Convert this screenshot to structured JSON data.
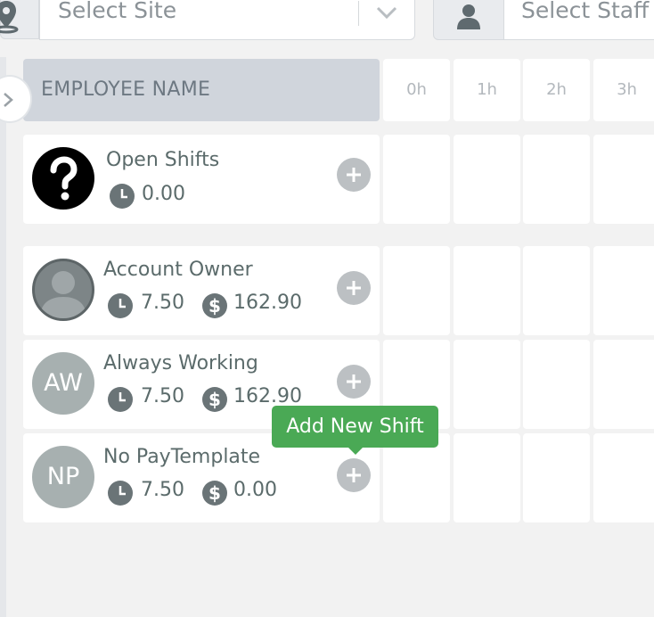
{
  "filters": {
    "site_placeholder": "Select Site",
    "staff_placeholder": "Select Staff"
  },
  "header": {
    "employee_column": "EMPLOYEE NAME",
    "hours": [
      "0h",
      "1h",
      "2h",
      "3h"
    ]
  },
  "rows": [
    {
      "name": "Open Shifts",
      "avatar": "question-icon",
      "hours": "0.00",
      "cost": ""
    },
    {
      "name": "Account Owner",
      "avatar": "person-icon",
      "hours": "7.50",
      "cost": "162.90"
    },
    {
      "name": "Always Working",
      "avatar_initials": "AW",
      "hours": "7.50",
      "cost": "162.90"
    },
    {
      "name": "No PayTemplate",
      "avatar_initials": "NP",
      "hours": "7.50",
      "cost": "0.00"
    }
  ],
  "tooltip": "Add New Shift",
  "colors": {
    "tooltip_bg": "#4aa955",
    "header_bg": "#d0d5dc",
    "add_button": "#bcc0c3",
    "initials_avatar": "#a7b0b0"
  }
}
